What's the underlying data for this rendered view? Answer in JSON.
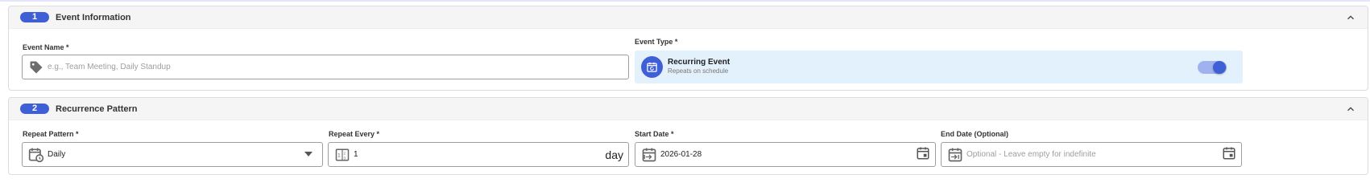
{
  "section1": {
    "step": "1",
    "title": "Event Information",
    "event_name": {
      "label": "Event Name *",
      "placeholder": "e.g., Team Meeting, Daily Standup",
      "icon": "tag-icon"
    },
    "event_type": {
      "label": "Event Type *",
      "option_title": "Recurring Event",
      "option_subtitle": "Repeats on schedule",
      "icon": "calendar-repeat-icon",
      "toggle_on": true
    }
  },
  "section2": {
    "step": "2",
    "title": "Recurrence Pattern",
    "repeat_pattern": {
      "label": "Repeat Pattern *",
      "value": "Daily",
      "icon": "calendar-clock-icon"
    },
    "repeat_every": {
      "label": "Repeat Every *",
      "value": "1",
      "unit": "day",
      "icon": "number-icon"
    },
    "start_date": {
      "label": "Start Date *",
      "value": "2026-01-28",
      "icon": "calendar-start-icon"
    },
    "end_date": {
      "label": "End Date (Optional)",
      "placeholder": "Optional - Leave empty for indefinite",
      "icon": "calendar-end-icon"
    }
  },
  "colors": {
    "accent": "#3f5fd7",
    "accent_light": "#e3f1fc",
    "border": "#9e9e9e"
  }
}
